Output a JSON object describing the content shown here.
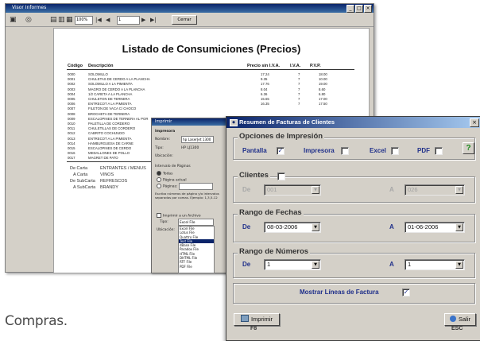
{
  "preview": {
    "title": "Visor Informes",
    "zoom": "100%",
    "page_box": "1",
    "close_label": "Cerrar",
    "report_title": "Listado de Consumiciones (Precios)",
    "columns": [
      "Código",
      "Descripción",
      "Precio sin I.V.A.",
      "I.V.A.",
      "P.V.P."
    ],
    "rows": [
      [
        "0000",
        "SOLOMILLO",
        "17.24",
        "7",
        "18.00"
      ],
      [
        "0001",
        "CHULETAS DE CERDO A LA PLANCHA",
        "9.35",
        "7",
        "10.00"
      ],
      [
        "0002",
        "SOLOMILLO A LA PIMIENTA",
        "17.76",
        "7",
        "19.00"
      ],
      [
        "0003",
        "MAGRO DE CERDO A LA PLANCHA",
        "8.04",
        "7",
        "8.60"
      ],
      [
        "0004",
        "1/2 CARETA A LA PLANCHA",
        "6.36",
        "7",
        "6.80"
      ],
      [
        "0005",
        "CHULETON DE TERNERA",
        "15.65",
        "7",
        "17.00"
      ],
      [
        "0006",
        "ENTRECOT A LA PIMIENTA",
        "16.35",
        "7",
        "17.50"
      ],
      [
        "0007",
        "FILETON DE VACA C/ CHOCO",
        "",
        "",
        ""
      ],
      [
        "0008",
        "BROCHETA DE TERNERA",
        "",
        "",
        ""
      ],
      [
        "0009",
        "ESCALOPINES DE TERNERA AL POR",
        "",
        "",
        ""
      ],
      [
        "0010",
        "PALETILLA DE CORDERO",
        "",
        "",
        ""
      ],
      [
        "0011",
        "CHULETILLAS DE CORDERO",
        "",
        "",
        ""
      ],
      [
        "0012",
        "CABRITO COCHIJUDO",
        "",
        "",
        ""
      ],
      [
        "0013",
        "ENTRECOT A LA PIMIENTA",
        "",
        "",
        ""
      ],
      [
        "0014",
        "HAMBURGUESA DE CARNE",
        "",
        "",
        ""
      ],
      [
        "0015",
        "ESCALOPINES DE CERDO",
        "",
        "",
        ""
      ],
      [
        "0016",
        "MEDALLONES DE POLLO",
        "",
        "",
        ""
      ],
      [
        "0017",
        "MAGRET DE PATO",
        "",
        "",
        ""
      ]
    ],
    "summary": [
      {
        "label": "De Carta",
        "value": "ENTRANTES / MENUS"
      },
      {
        "label": "A Carta",
        "value": "VINOS"
      },
      {
        "label": "De SubCarta",
        "value": "REFRESCOS"
      },
      {
        "label": "A SubCarta",
        "value": "BRANDY"
      }
    ]
  },
  "print_dialog": {
    "title": "Imprimir",
    "section": "Impresora",
    "name_label": "Nombre:",
    "name_value": "hp LaserJet 1300",
    "type_label": "Tipo:",
    "type_value": "HP LJ1300",
    "location_label": "Ubicación:",
    "range_label": "Intervalo de Páginas",
    "range_all": "Todas",
    "range_current": "Página actual",
    "range_pages": "Páginas:",
    "help_text": "Escriba números de página y/o intervalos separados por comas. Ejemplo: 1,3,5-12",
    "to_file_label": "Imprimir a un Archivo",
    "file_type_label": "Tipo:",
    "file_type_value": "Excel File",
    "location2_label": "Ubicación:",
    "file_types": [
      "Excel File",
      "Lotus File",
      "Quattro File",
      "Text File",
      "dBase File",
      "Paradox File",
      "HTML File",
      "DHTML File",
      "RTF File",
      "PDF File"
    ],
    "file_types_selected_index": 3
  },
  "dialog": {
    "title": "Resumen de Facturas de Clientes",
    "opciones_label": "Opciones de Impresión",
    "pantalla_label": "Pantalla",
    "pantalla_checked": true,
    "impresora_label": "Impresora",
    "impresora_checked": false,
    "excel_label": "Excel",
    "excel_checked": false,
    "pdf_label": "PDF",
    "pdf_checked": false,
    "help_glyph": "?",
    "clientes_label": "Clientes",
    "clientes_checked": false,
    "clientes_de_label": "De",
    "clientes_de_value": "001",
    "clientes_a_label": "A",
    "clientes_a_value": "026",
    "fechas_label": "Rango de Fechas",
    "fechas_de_label": "De",
    "fechas_de_value": "08-03-2006",
    "fechas_a_label": "A",
    "fechas_a_value": "01-06-2006",
    "numeros_label": "Rango de Números",
    "numeros_de_label": "De",
    "numeros_de_value": "1",
    "numeros_a_label": "A",
    "numeros_a_value": "1",
    "mostrar_label": "Mostrar Líneas de Factura",
    "mostrar_checked": true,
    "imprimir_label": "Imprimir",
    "imprimir_key": "F8",
    "salir_label": "Salir",
    "salir_key": "ESC"
  },
  "caption": "Compras.",
  "colors": {
    "title_bar": "#0a246a",
    "dialog_face": "#d4d0c8",
    "label_blue": "#1f2f8a"
  }
}
